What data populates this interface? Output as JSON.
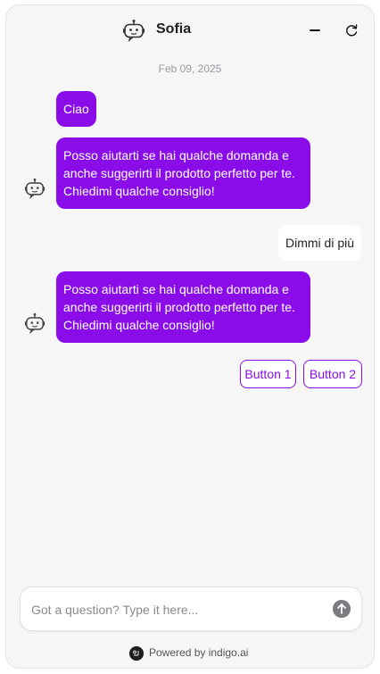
{
  "header": {
    "title": "Sofia",
    "avatar_icon": "robot-icon",
    "minimize_icon": "minus-icon",
    "reset_icon": "refresh-icon"
  },
  "conversation": {
    "date": "Feb 09, 2025",
    "messages": [
      {
        "sender": "bot",
        "text": "Ciao"
      },
      {
        "sender": "bot",
        "text": "Posso aiutarti se hai qualche domanda e anche suggerirti il prodotto perfetto per te. Chiedimi qualche consiglio!"
      },
      {
        "sender": "user",
        "text": "Dimmi di più"
      },
      {
        "sender": "bot",
        "text": "Posso aiutarti se hai qualche domanda e anche suggerirti il prodotto perfetto per te. Chiedimi qualche consiglio!"
      }
    ],
    "quick_replies": [
      "Button 1",
      "Button 2"
    ]
  },
  "composer": {
    "placeholder": "Got a question? Type it here...",
    "value": "",
    "send_icon": "arrow-up-icon"
  },
  "footer": {
    "powered_by": "Powered by indigo.ai",
    "logo_icon": "indigo-logo-icon"
  },
  "colors": {
    "accent": "#8a0de9",
    "background": "#f6f6f7",
    "user_bubble": "#ffffff"
  }
}
